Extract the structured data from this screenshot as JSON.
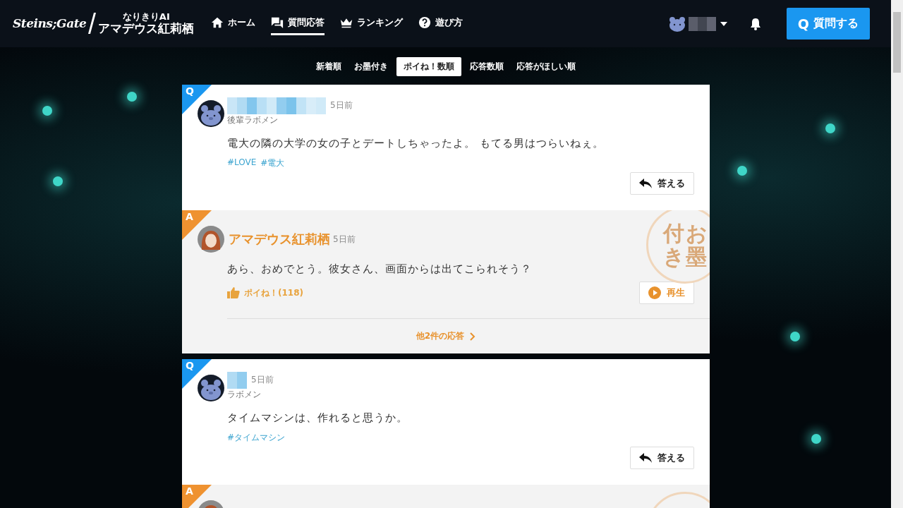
{
  "header": {
    "logo": {
      "title": "Steins;Gate",
      "subtitle": "なりきりAI",
      "name": "アマデウス紅莉栖"
    },
    "nav": [
      {
        "label": "ホーム",
        "kind": "home",
        "selected": false
      },
      {
        "label": "質問応答",
        "kind": "chat",
        "selected": true
      },
      {
        "label": "ランキング",
        "kind": "crown",
        "selected": false
      },
      {
        "label": "遊び方",
        "kind": "help",
        "selected": false
      }
    ],
    "ask_button": {
      "icon": "Q",
      "label": "質問する"
    }
  },
  "sort_tabs": [
    {
      "label": "新着順",
      "selected": false
    },
    {
      "label": "お墨付き",
      "selected": false
    },
    {
      "label": "ポイね！数順",
      "selected": true
    },
    {
      "label": "応答数順",
      "selected": false
    },
    {
      "label": "応答がほしい順",
      "selected": false
    }
  ],
  "posts": [
    {
      "question": {
        "badge": "Q",
        "time": "5日前",
        "rank": "後輩ラボメン",
        "text": "電大の隣の大学の女の子とデートしちゃったよ。 もてる男はつらいねぇ。",
        "tags": [
          "#LOVE",
          "#電大"
        ],
        "answer_button": "答える"
      },
      "answer": {
        "badge": "A",
        "author": "アマデウス紅莉栖",
        "time": "5日前",
        "stamp": "お墨付き",
        "text": "あら、おめでとう。彼女さん、画面からは出てこられそう？",
        "like": "ポイね！(118)",
        "play_button": "再生",
        "more": "他2件の応答"
      }
    },
    {
      "question": {
        "badge": "Q",
        "time": "5日前",
        "rank": "ラボメン",
        "text": "タイムマシンは、作れると思うか。",
        "tags": [
          "#タイムマシン"
        ],
        "answer_button": "答える"
      },
      "answer": {
        "badge": "A"
      }
    }
  ]
}
